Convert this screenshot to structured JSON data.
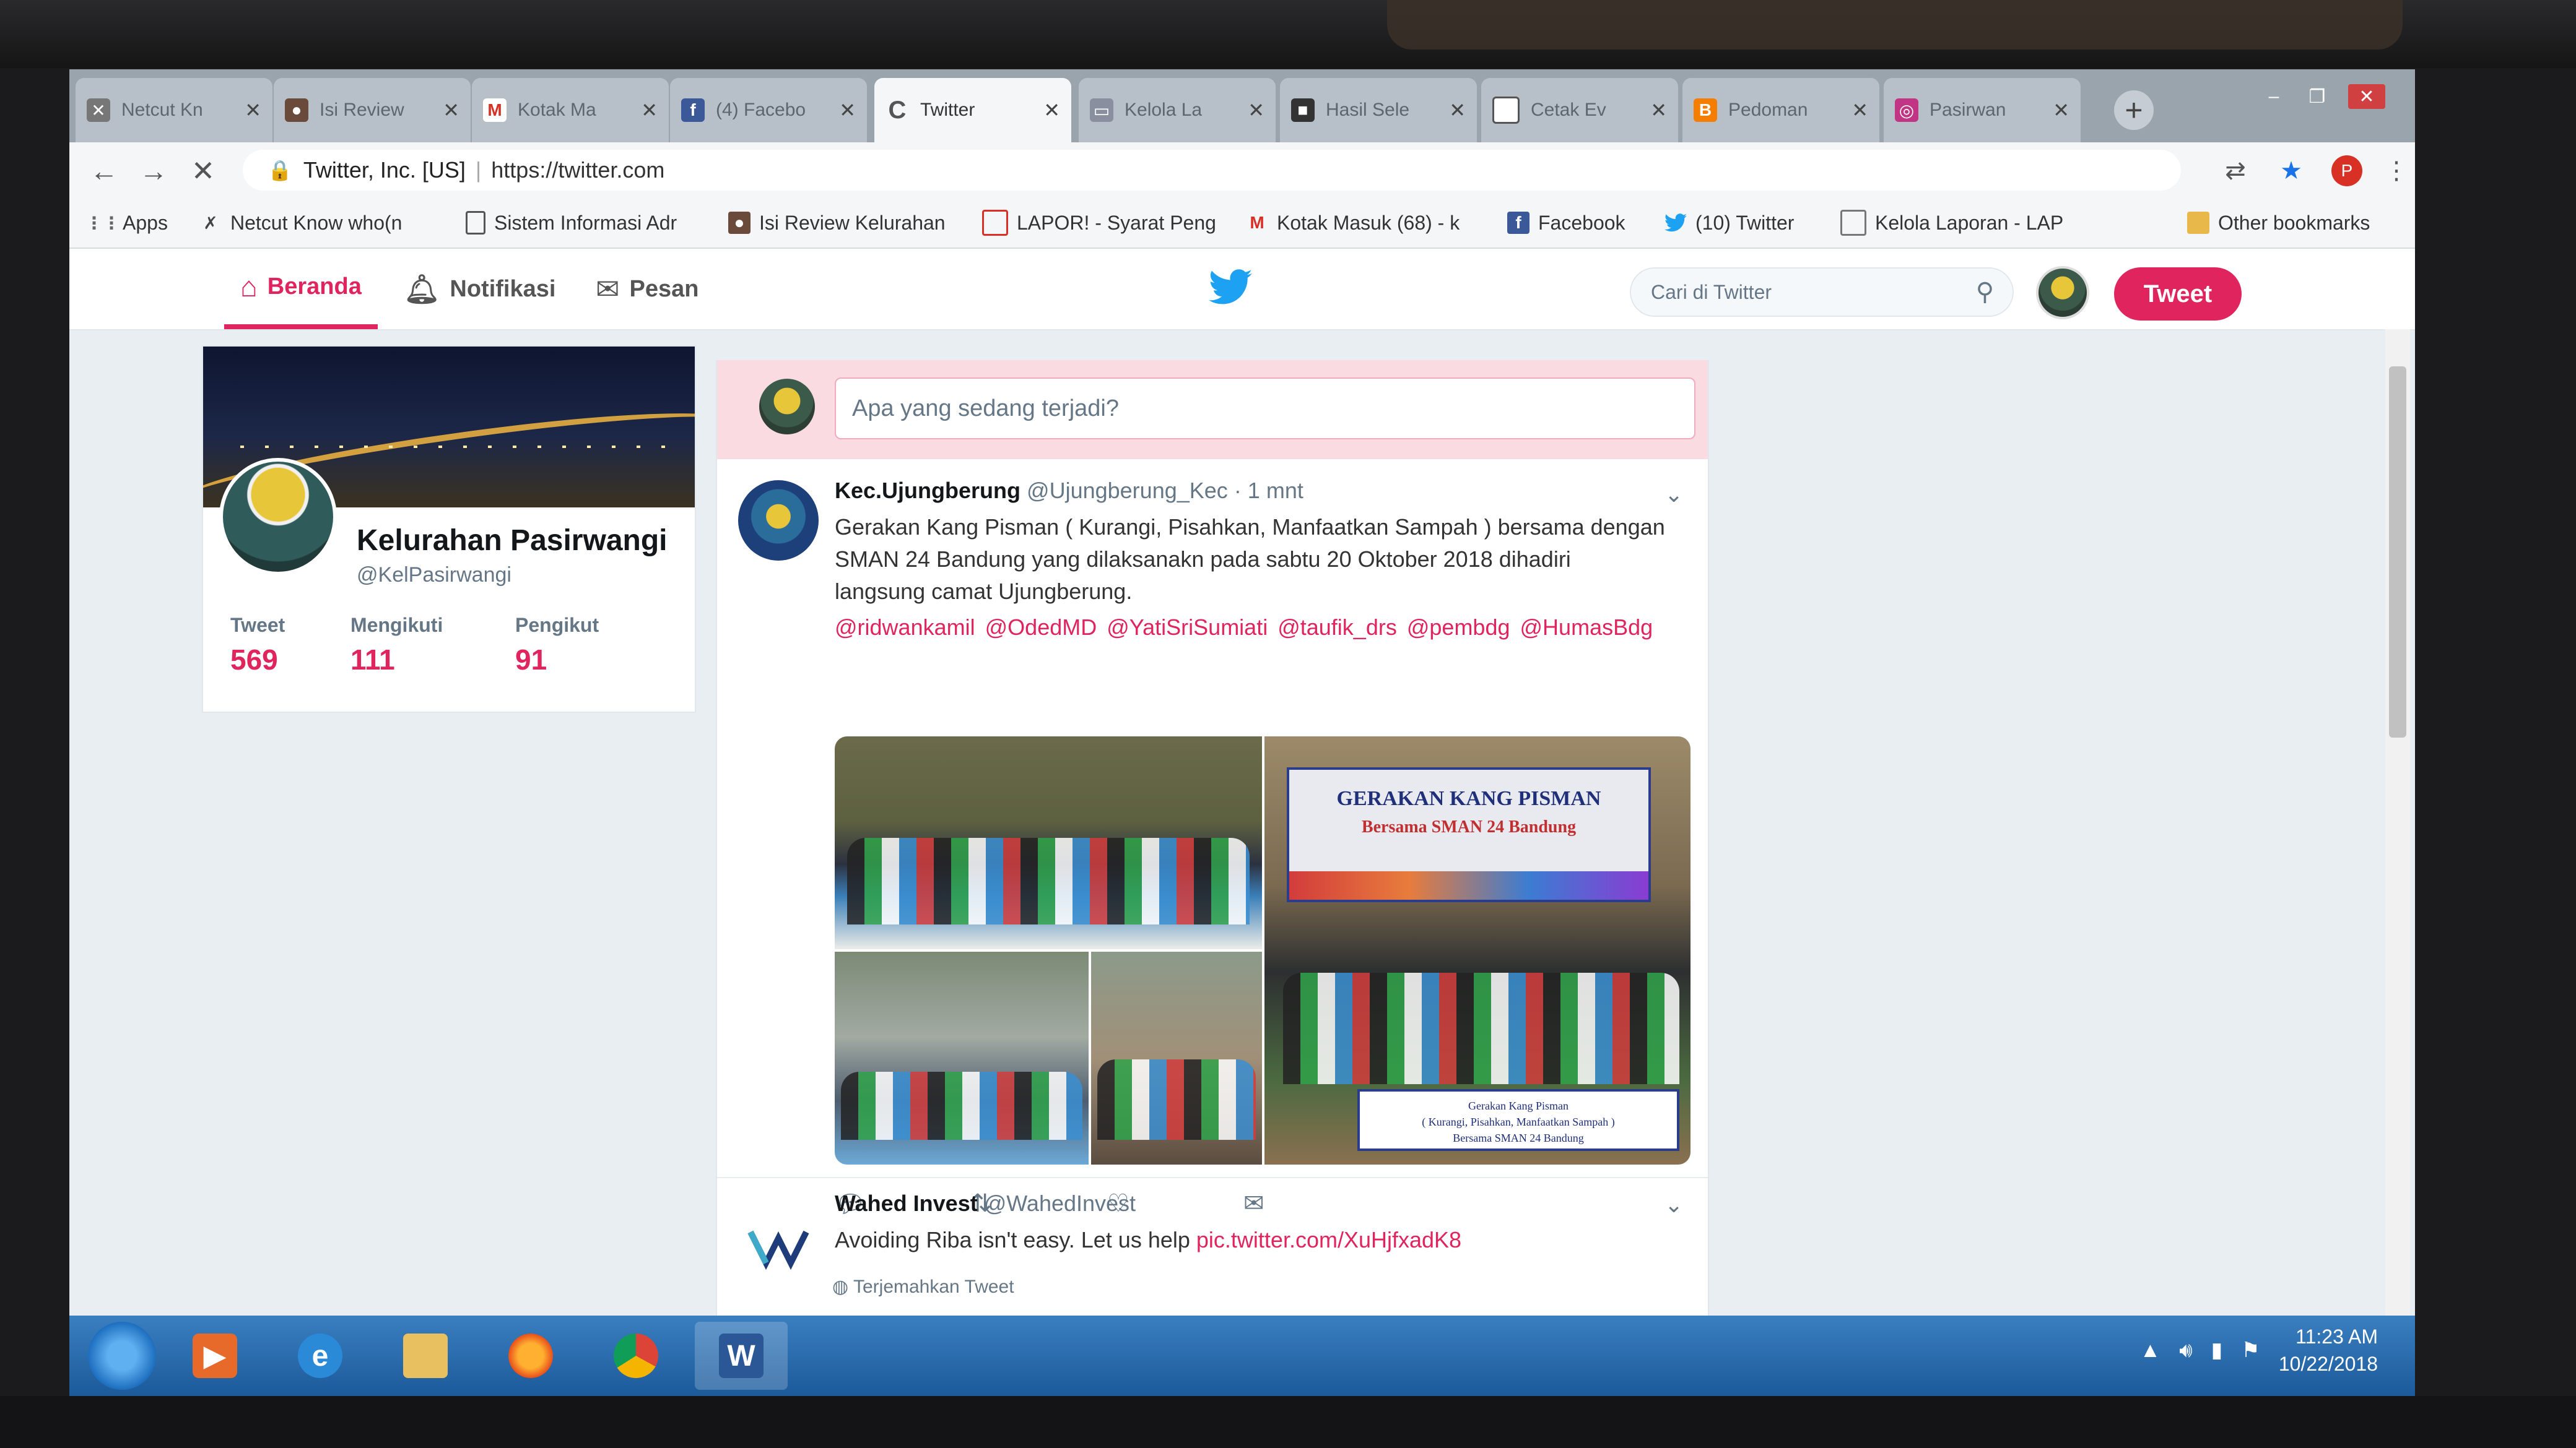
{
  "browser": {
    "tabs": [
      {
        "label": "Netcut Kn",
        "icon": "netcut-icon"
      },
      {
        "label": "Isi Review",
        "icon": "person-icon"
      },
      {
        "label": "Kotak Ma",
        "icon": "gmail-icon"
      },
      {
        "label": "(4) Facebo",
        "icon": "facebook-icon"
      },
      {
        "label": "Twitter",
        "icon": "loading-icon",
        "active": true
      },
      {
        "label": "Kelola La",
        "icon": "lapor-icon"
      },
      {
        "label": "Hasil Sele",
        "icon": "app-icon"
      },
      {
        "label": "Cetak Ev",
        "icon": "page-icon"
      },
      {
        "label": "Pedoman",
        "icon": "blogger-icon"
      },
      {
        "label": "Pasirwan",
        "icon": "instagram-icon"
      }
    ],
    "address": {
      "site_name": "Twitter, Inc. [US]",
      "url": "https://twitter.com"
    },
    "profile_initial": "P",
    "bookmarks": [
      {
        "label": "Apps",
        "icon": "apps-grid-icon"
      },
      {
        "label": "Netcut Know who(n",
        "icon": "netcut-icon"
      },
      {
        "label": "Sistem Informasi Adr",
        "icon": "page-icon"
      },
      {
        "label": "Isi Review Kelurahan",
        "icon": "person-icon"
      },
      {
        "label": "LAPOR! - Syarat Peng",
        "icon": "lapor-icon"
      },
      {
        "label": "Kotak Masuk (68) - k",
        "icon": "gmail-icon"
      },
      {
        "label": "Facebook",
        "icon": "facebook-icon"
      },
      {
        "label": "(10) Twitter",
        "icon": "twitter-icon"
      },
      {
        "label": "Kelola Laporan - LAP",
        "icon": "lapor-icon"
      },
      {
        "label": "Other bookmarks",
        "icon": "folder-icon"
      }
    ]
  },
  "twitter": {
    "nav": {
      "home": "Beranda",
      "notifications": "Notifikasi",
      "messages": "Pesan"
    },
    "search_placeholder": "Cari di Twitter",
    "tweet_button": "Tweet",
    "accent": "#e0245e",
    "profile": {
      "name": "Kelurahan Pasirwangi",
      "handle": "@KelPasirwangi",
      "stats": [
        {
          "label": "Tweet",
          "value": "569"
        },
        {
          "label": "Mengikuti",
          "value": "111"
        },
        {
          "label": "Pengikut",
          "value": "91"
        }
      ]
    },
    "compose_placeholder": "Apa yang sedang terjadi?",
    "tweets": [
      {
        "name": "Kec.Ujungberung",
        "handle": "@Ujungberung_Kec",
        "time": "· 1 mnt",
        "text_lines": [
          "Gerakan Kang Pisman ( Kurangi, Pisahkan, Manfaatkan Sampah ) bersama dengan",
          "SMAN 24 Bandung yang dilaksanakn pada sabtu 20 Oktober 2018 dihadiri",
          "langsung camat Ujungberung."
        ],
        "mentions": [
          "@ridwankamil",
          "@OdedMD",
          "@YatiSriSumiati",
          "@taufik_drs",
          "@pembdg",
          "@HumasBdg"
        ],
        "banner_title": "GERAKAN KANG PISMAN",
        "banner_sub": "Bersama SMAN 24 Bandung",
        "caption_lines": [
          "Gerakan Kang Pisman",
          "( Kurangi, Pisahkan, Manfaatkan Sampah )",
          "Bersama SMAN 24 Bandung"
        ]
      },
      {
        "name": "Wahed Invest",
        "handle": "@WahedInvest",
        "text": "Avoiding Riba isn't easy. Let us help",
        "link": "pic.twitter.com/XuHjfxadK8",
        "translate": "Terjemahkan Tweet"
      }
    ]
  },
  "taskbar": {
    "apps": [
      "media-player-icon",
      "internet-explorer-icon",
      "file-explorer-icon",
      "firefox-icon",
      "chrome-icon",
      "word-icon"
    ],
    "word_letter": "W",
    "time": "11:23 AM",
    "date": "10/22/2018"
  }
}
